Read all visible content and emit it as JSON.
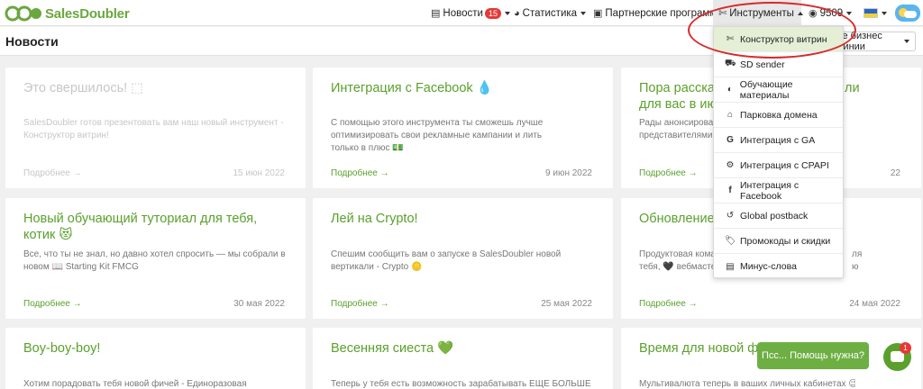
{
  "nav": {
    "logo_text": "SalesDoubler",
    "news_label": "Новости",
    "news_badge": "15",
    "stats_label": "Статистика",
    "partner_label": "Партнерские программы",
    "tools_label": "Инструменты",
    "account_label": "9509"
  },
  "subheader": {
    "title": "Новости",
    "business_lines_label": "се бизнес линии"
  },
  "cards": [
    {
      "title": "Это свершилось! ⬚",
      "desc": "SalesDoubler готов презентовать вам наш новый инструмент - Конструктор витрин!",
      "more": "Подробнее →",
      "date": "15 июн 2022"
    },
    {
      "title": "Интеграция с Facebook 💧",
      "desc": "С помощью этого инструмента ты сможешь лучше оптимизировать свои рекламные кампании и лить только в плюс 💵",
      "more": "Подробнее →",
      "date": "9 июн 2022"
    },
    {
      "title": "Пора рассказ",
      "title2": "ли",
      "title3": "для вас в июн",
      "desc": "Рады анонсироват",
      "desc2": "представителями М",
      "more": "Подробнее →",
      "date": "22"
    },
    {
      "title": "Новый обучающий туториал для тебя, котик 😻",
      "desc": "Все, что ты не знал, но давно хотел спросить — мы собрали в новом 📖 Starting Kit FMCG",
      "more": "Подробнее →",
      "date": "30 мая 2022"
    },
    {
      "title": "Лей на Crypto!",
      "desc": "Спешим сообщить вам о запуске в SalesDoubler новой вертикали - Crypto 🪙",
      "more": "Подробнее →",
      "date": "25 мая 2022"
    },
    {
      "title": "Обновление в",
      "desc": "Продуктовая коман",
      "desc2": "тебя, 🖤 вебмастер!",
      "desc3": "ля",
      "desc4": "ю",
      "more": "Подробнее →",
      "date": "24 мая 2022"
    },
    {
      "title": "Boy-boy-boy!",
      "desc": "Хотим порадовать тебя новой фичей - Единоразовая"
    },
    {
      "title": "Весенняя сиеста 💚",
      "desc": "Теперь у тебя есть возможность зарабатывать ЕЩЕ БОЛЬШЕ"
    },
    {
      "title": "Время для новой фич",
      "desc": "Мультивалюта теперь в ваших личных кабинетах 😉"
    }
  ],
  "dropdown": [
    {
      "label": "Конструктор витрин",
      "icon": "✄"
    },
    {
      "label": "SD sender",
      "icon": "⛟"
    },
    {
      "label": "Обучающие материалы",
      "icon": "◐"
    },
    {
      "label": "Парковка домена",
      "icon": "⌂"
    },
    {
      "label": "Интеграция с GA",
      "icon": "G"
    },
    {
      "label": "Интеграция с CPAPI",
      "icon": "⚙"
    },
    {
      "label": "Интеграция с Facebook",
      "icon": "f"
    },
    {
      "label": "Global postback",
      "icon": "↺"
    },
    {
      "label": "Промокоды и скидки",
      "icon": "🏷"
    },
    {
      "label": "Минус-слова",
      "icon": "▤"
    }
  ],
  "help": {
    "label": "Псс... Помощь нужна?",
    "badge": "1"
  },
  "colors": {
    "brand_green": "#5ba02c",
    "badge_red": "#e53935",
    "highlight_oval": "#d82a2a"
  }
}
